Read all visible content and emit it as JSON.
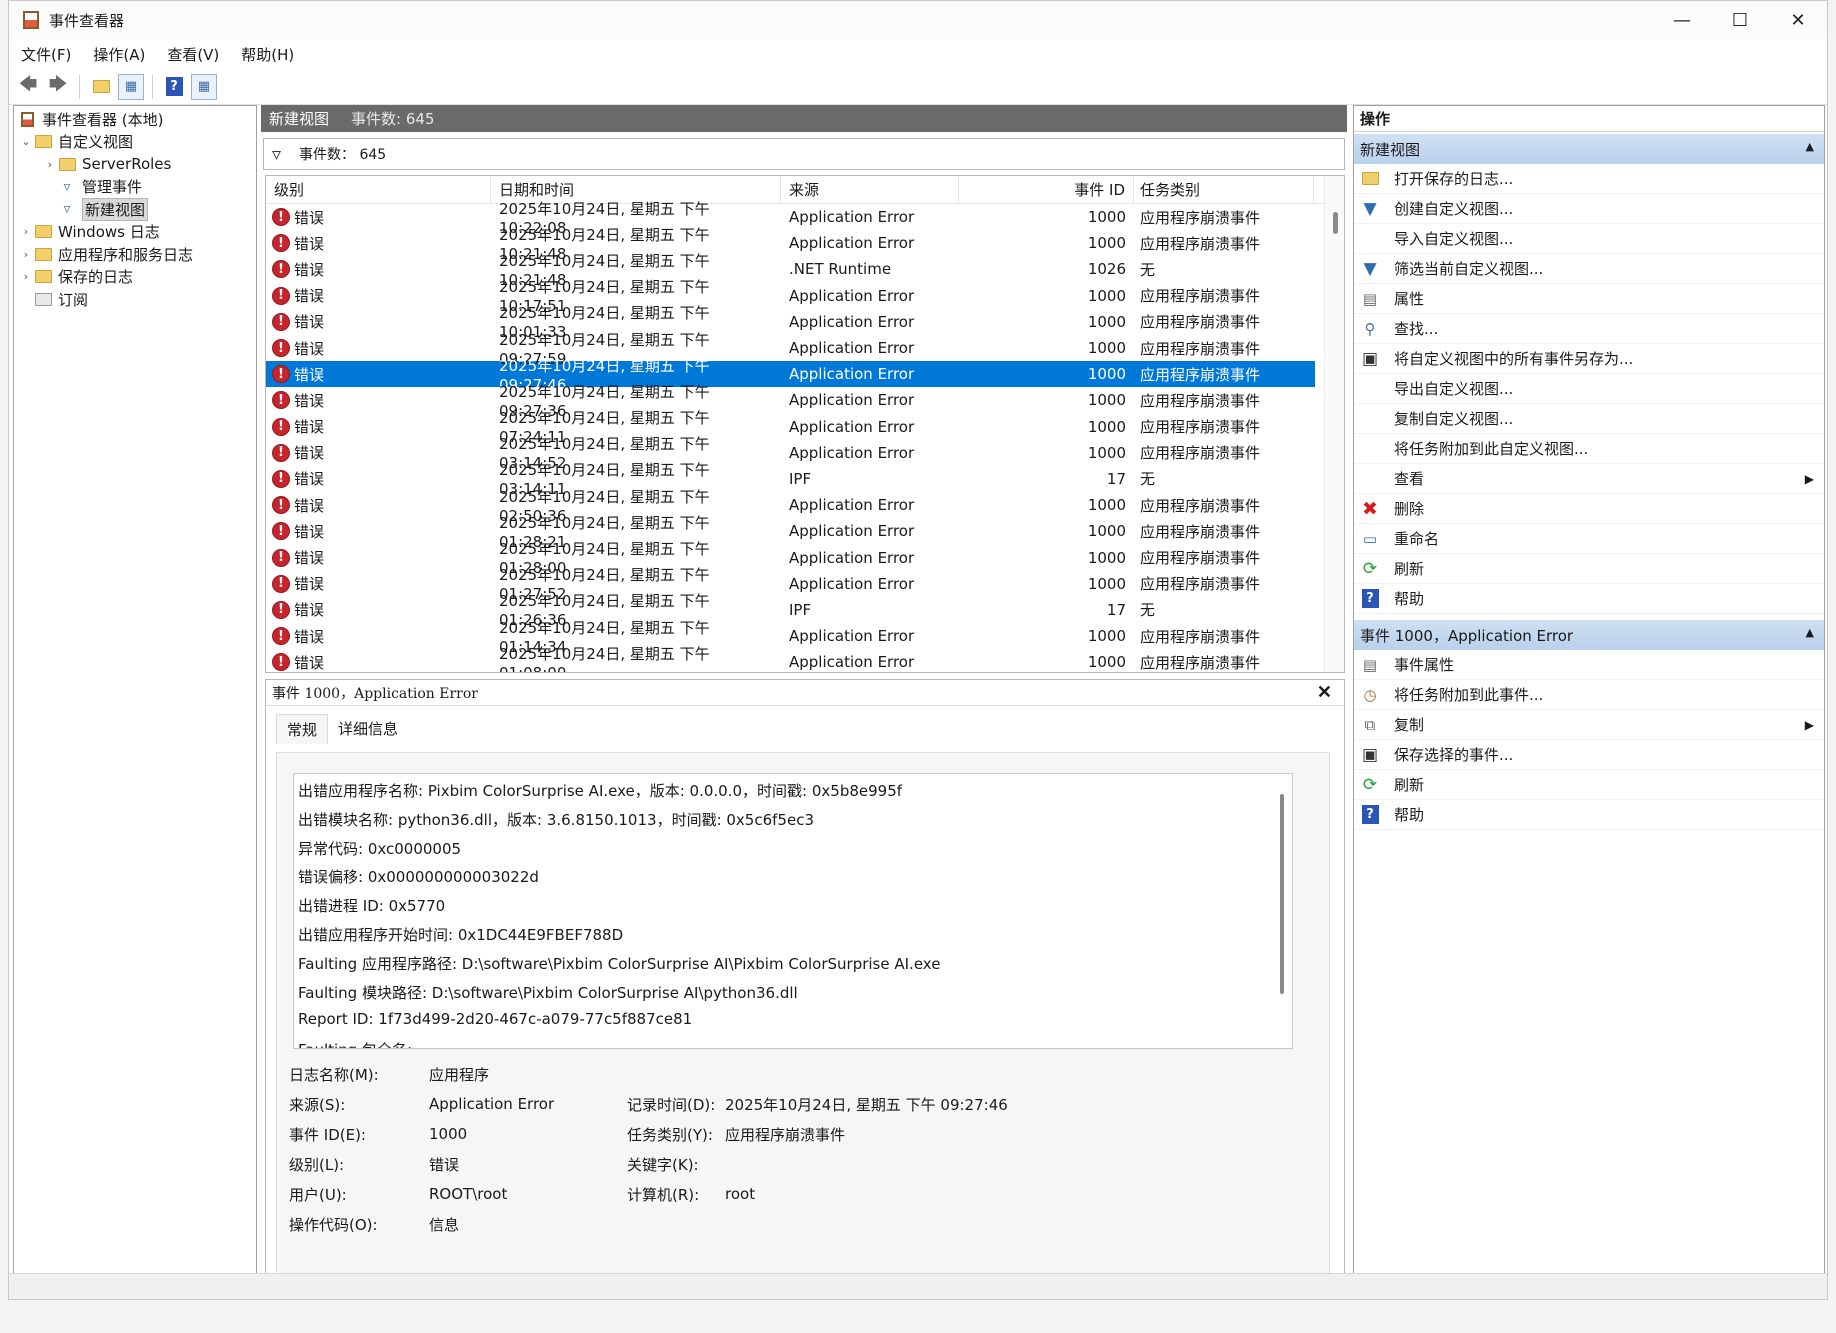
{
  "window": {
    "title": "事件查看器"
  },
  "menu": [
    "文件(F)",
    "操作(A)",
    "查看(V)",
    "帮助(H)"
  ],
  "tree": {
    "root": "事件查看器 (本地)",
    "custom_views": "自定义视图",
    "server_roles": "ServerRoles",
    "admin_events": "管理事件",
    "new_view": "新建视图",
    "windows_logs": "Windows 日志",
    "app_service_logs": "应用程序和服务日志",
    "saved_logs": "保存的日志",
    "subscriptions": "订阅"
  },
  "center": {
    "header_title": "新建视图",
    "header_count": "事件数: 645",
    "filter_label": "事件数： 645"
  },
  "grid": {
    "columns": [
      "级别",
      "日期和时间",
      "来源",
      "事件 ID",
      "任务类别"
    ],
    "rows": [
      {
        "level": "错误",
        "datetime": "2025年10月24日, 星期五 下午 10:22:08",
        "source": "Application Error",
        "id": "1000",
        "category": "应用程序崩溃事件"
      },
      {
        "level": "错误",
        "datetime": "2025年10月24日, 星期五 下午 10:21:48",
        "source": "Application Error",
        "id": "1000",
        "category": "应用程序崩溃事件"
      },
      {
        "level": "错误",
        "datetime": "2025年10月24日, 星期五 下午 10:21:48",
        "source": ".NET Runtime",
        "id": "1026",
        "category": "无"
      },
      {
        "level": "错误",
        "datetime": "2025年10月24日, 星期五 下午 10:17:51",
        "source": "Application Error",
        "id": "1000",
        "category": "应用程序崩溃事件"
      },
      {
        "level": "错误",
        "datetime": "2025年10月24日, 星期五 下午 10:01:33",
        "source": "Application Error",
        "id": "1000",
        "category": "应用程序崩溃事件"
      },
      {
        "level": "错误",
        "datetime": "2025年10月24日, 星期五 下午 09:27:59",
        "source": "Application Error",
        "id": "1000",
        "category": "应用程序崩溃事件"
      },
      {
        "level": "错误",
        "datetime": "2025年10月24日, 星期五 下午 09:27:46",
        "source": "Application Error",
        "id": "1000",
        "category": "应用程序崩溃事件"
      },
      {
        "level": "错误",
        "datetime": "2025年10月24日, 星期五 下午 09:27:36",
        "source": "Application Error",
        "id": "1000",
        "category": "应用程序崩溃事件"
      },
      {
        "level": "错误",
        "datetime": "2025年10月24日, 星期五 下午 07:24:11",
        "source": "Application Error",
        "id": "1000",
        "category": "应用程序崩溃事件"
      },
      {
        "level": "错误",
        "datetime": "2025年10月24日, 星期五 下午 03:14:52",
        "source": "Application Error",
        "id": "1000",
        "category": "应用程序崩溃事件"
      },
      {
        "level": "错误",
        "datetime": "2025年10月24日, 星期五 下午 03:14:11",
        "source": "IPF",
        "id": "17",
        "category": "无"
      },
      {
        "level": "错误",
        "datetime": "2025年10月24日, 星期五 下午 02:50:36",
        "source": "Application Error",
        "id": "1000",
        "category": "应用程序崩溃事件"
      },
      {
        "level": "错误",
        "datetime": "2025年10月24日, 星期五 下午 01:28:21",
        "source": "Application Error",
        "id": "1000",
        "category": "应用程序崩溃事件"
      },
      {
        "level": "错误",
        "datetime": "2025年10月24日, 星期五 下午 01:28:00",
        "source": "Application Error",
        "id": "1000",
        "category": "应用程序崩溃事件"
      },
      {
        "level": "错误",
        "datetime": "2025年10月24日, 星期五 下午 01:27:52",
        "source": "Application Error",
        "id": "1000",
        "category": "应用程序崩溃事件"
      },
      {
        "level": "错误",
        "datetime": "2025年10月24日, 星期五 下午 01:26:36",
        "source": "IPF",
        "id": "17",
        "category": "无"
      },
      {
        "level": "错误",
        "datetime": "2025年10月24日, 星期五 下午 01:14:34",
        "source": "Application Error",
        "id": "1000",
        "category": "应用程序崩溃事件"
      },
      {
        "level": "错误",
        "datetime": "2025年10月24日, 星期五 下午 01:08:00",
        "source": "Application Error",
        "id": "1000",
        "category": "应用程序崩溃事件"
      }
    ],
    "selected_index": 6
  },
  "details": {
    "title": "事件 1000，Application Error",
    "tabs": [
      "常规",
      "详细信息"
    ],
    "description": [
      "出错应用程序名称:  Pixbim ColorSurprise AI.exe，版本:  0.0.0.0，时间戳:  0x5b8e995f",
      "出错模块名称:  python36.dll，版本:  3.6.8150.1013，时间戳:  0x5c6f5ec3",
      "异常代码:  0xc0000005",
      "错误偏移:  0x000000000003022d",
      "出错进程 ID:  0x5770",
      "出错应用程序开始时间:  0x1DC44E9FBEF788D",
      "Faulting 应用程序路径:  D:\\software\\Pixbim ColorSurprise AI\\Pixbim ColorSurprise AI.exe",
      "Faulting 模块路径:  D:\\software\\Pixbim ColorSurprise AI\\python36.dll",
      "Report ID:  1f73d499-2d20-467c-a079-77c5f887ce81",
      "Faulting 包全名:"
    ],
    "props": {
      "log_name_label": "日志名称(M):",
      "log_name": "应用程序",
      "source_label": "来源(S):",
      "source": "Application Error",
      "logged_label": "记录时间(D):",
      "logged": "2025年10月24日, 星期五 下午 09:27:46",
      "event_id_label": "事件 ID(E):",
      "event_id": "1000",
      "task_label": "任务类别(Y):",
      "task": "应用程序崩溃事件",
      "level_label": "级别(L):",
      "level": "错误",
      "keywords_label": "关键字(K):",
      "keywords": "",
      "user_label": "用户(U):",
      "user": "ROOT\\root",
      "computer_label": "计算机(R):",
      "computer": "root",
      "opcode_label": "操作代码(O):",
      "opcode": "信息"
    }
  },
  "actions": {
    "title": "操作",
    "section1": "新建视图",
    "items1": [
      {
        "label": "打开保存的日志...",
        "icon": "folder-open-icon"
      },
      {
        "label": "创建自定义视图...",
        "icon": "filter-icon"
      },
      {
        "label": "导入自定义视图...",
        "icon": ""
      },
      {
        "label": "筛选当前自定义视图...",
        "icon": "filter-icon"
      },
      {
        "label": "属性",
        "icon": "properties-icon"
      },
      {
        "label": "查找...",
        "icon": "find-icon"
      },
      {
        "label": "将自定义视图中的所有事件另存为...",
        "icon": "save-icon"
      },
      {
        "label": "导出自定义视图...",
        "icon": ""
      },
      {
        "label": "复制自定义视图...",
        "icon": ""
      },
      {
        "label": "将任务附加到此自定义视图...",
        "icon": ""
      },
      {
        "label": "查看",
        "icon": "",
        "submenu": true
      },
      {
        "label": "删除",
        "icon": "delete-icon"
      },
      {
        "label": "重命名",
        "icon": "rename-icon"
      },
      {
        "label": "刷新",
        "icon": "refresh-icon"
      },
      {
        "label": "帮助",
        "icon": "help-icon",
        "submenu": true
      }
    ],
    "section2": "事件 1000，Application Error",
    "items2": [
      {
        "label": "事件属性",
        "icon": "properties-icon"
      },
      {
        "label": "将任务附加到此事件...",
        "icon": "task-icon"
      },
      {
        "label": "复制",
        "icon": "copy-icon",
        "submenu": true
      },
      {
        "label": "保存选择的事件...",
        "icon": "save-icon"
      },
      {
        "label": "刷新",
        "icon": "refresh-icon"
      },
      {
        "label": "帮助",
        "icon": "help-icon",
        "submenu": true
      }
    ]
  }
}
